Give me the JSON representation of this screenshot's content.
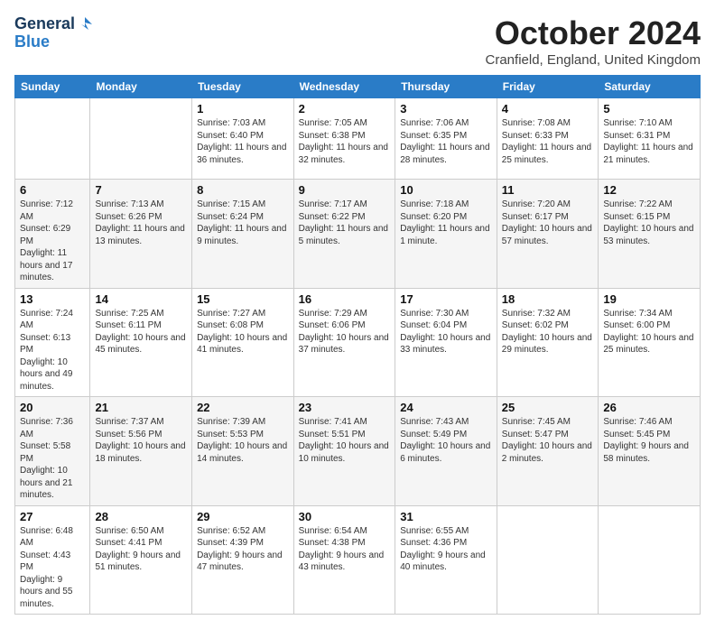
{
  "header": {
    "logo_general": "General",
    "logo_blue": "Blue",
    "month": "October 2024",
    "location": "Cranfield, England, United Kingdom"
  },
  "columns": [
    "Sunday",
    "Monday",
    "Tuesday",
    "Wednesday",
    "Thursday",
    "Friday",
    "Saturday"
  ],
  "weeks": [
    [
      {
        "day": "",
        "info": ""
      },
      {
        "day": "",
        "info": ""
      },
      {
        "day": "1",
        "info": "Sunrise: 7:03 AM\nSunset: 6:40 PM\nDaylight: 11 hours and 36 minutes."
      },
      {
        "day": "2",
        "info": "Sunrise: 7:05 AM\nSunset: 6:38 PM\nDaylight: 11 hours and 32 minutes."
      },
      {
        "day": "3",
        "info": "Sunrise: 7:06 AM\nSunset: 6:35 PM\nDaylight: 11 hours and 28 minutes."
      },
      {
        "day": "4",
        "info": "Sunrise: 7:08 AM\nSunset: 6:33 PM\nDaylight: 11 hours and 25 minutes."
      },
      {
        "day": "5",
        "info": "Sunrise: 7:10 AM\nSunset: 6:31 PM\nDaylight: 11 hours and 21 minutes."
      }
    ],
    [
      {
        "day": "6",
        "info": "Sunrise: 7:12 AM\nSunset: 6:29 PM\nDaylight: 11 hours and 17 minutes."
      },
      {
        "day": "7",
        "info": "Sunrise: 7:13 AM\nSunset: 6:26 PM\nDaylight: 11 hours and 13 minutes."
      },
      {
        "day": "8",
        "info": "Sunrise: 7:15 AM\nSunset: 6:24 PM\nDaylight: 11 hours and 9 minutes."
      },
      {
        "day": "9",
        "info": "Sunrise: 7:17 AM\nSunset: 6:22 PM\nDaylight: 11 hours and 5 minutes."
      },
      {
        "day": "10",
        "info": "Sunrise: 7:18 AM\nSunset: 6:20 PM\nDaylight: 11 hours and 1 minute."
      },
      {
        "day": "11",
        "info": "Sunrise: 7:20 AM\nSunset: 6:17 PM\nDaylight: 10 hours and 57 minutes."
      },
      {
        "day": "12",
        "info": "Sunrise: 7:22 AM\nSunset: 6:15 PM\nDaylight: 10 hours and 53 minutes."
      }
    ],
    [
      {
        "day": "13",
        "info": "Sunrise: 7:24 AM\nSunset: 6:13 PM\nDaylight: 10 hours and 49 minutes."
      },
      {
        "day": "14",
        "info": "Sunrise: 7:25 AM\nSunset: 6:11 PM\nDaylight: 10 hours and 45 minutes."
      },
      {
        "day": "15",
        "info": "Sunrise: 7:27 AM\nSunset: 6:08 PM\nDaylight: 10 hours and 41 minutes."
      },
      {
        "day": "16",
        "info": "Sunrise: 7:29 AM\nSunset: 6:06 PM\nDaylight: 10 hours and 37 minutes."
      },
      {
        "day": "17",
        "info": "Sunrise: 7:30 AM\nSunset: 6:04 PM\nDaylight: 10 hours and 33 minutes."
      },
      {
        "day": "18",
        "info": "Sunrise: 7:32 AM\nSunset: 6:02 PM\nDaylight: 10 hours and 29 minutes."
      },
      {
        "day": "19",
        "info": "Sunrise: 7:34 AM\nSunset: 6:00 PM\nDaylight: 10 hours and 25 minutes."
      }
    ],
    [
      {
        "day": "20",
        "info": "Sunrise: 7:36 AM\nSunset: 5:58 PM\nDaylight: 10 hours and 21 minutes."
      },
      {
        "day": "21",
        "info": "Sunrise: 7:37 AM\nSunset: 5:56 PM\nDaylight: 10 hours and 18 minutes."
      },
      {
        "day": "22",
        "info": "Sunrise: 7:39 AM\nSunset: 5:53 PM\nDaylight: 10 hours and 14 minutes."
      },
      {
        "day": "23",
        "info": "Sunrise: 7:41 AM\nSunset: 5:51 PM\nDaylight: 10 hours and 10 minutes."
      },
      {
        "day": "24",
        "info": "Sunrise: 7:43 AM\nSunset: 5:49 PM\nDaylight: 10 hours and 6 minutes."
      },
      {
        "day": "25",
        "info": "Sunrise: 7:45 AM\nSunset: 5:47 PM\nDaylight: 10 hours and 2 minutes."
      },
      {
        "day": "26",
        "info": "Sunrise: 7:46 AM\nSunset: 5:45 PM\nDaylight: 9 hours and 58 minutes."
      }
    ],
    [
      {
        "day": "27",
        "info": "Sunrise: 6:48 AM\nSunset: 4:43 PM\nDaylight: 9 hours and 55 minutes."
      },
      {
        "day": "28",
        "info": "Sunrise: 6:50 AM\nSunset: 4:41 PM\nDaylight: 9 hours and 51 minutes."
      },
      {
        "day": "29",
        "info": "Sunrise: 6:52 AM\nSunset: 4:39 PM\nDaylight: 9 hours and 47 minutes."
      },
      {
        "day": "30",
        "info": "Sunrise: 6:54 AM\nSunset: 4:38 PM\nDaylight: 9 hours and 43 minutes."
      },
      {
        "day": "31",
        "info": "Sunrise: 6:55 AM\nSunset: 4:36 PM\nDaylight: 9 hours and 40 minutes."
      },
      {
        "day": "",
        "info": ""
      },
      {
        "day": "",
        "info": ""
      }
    ]
  ]
}
